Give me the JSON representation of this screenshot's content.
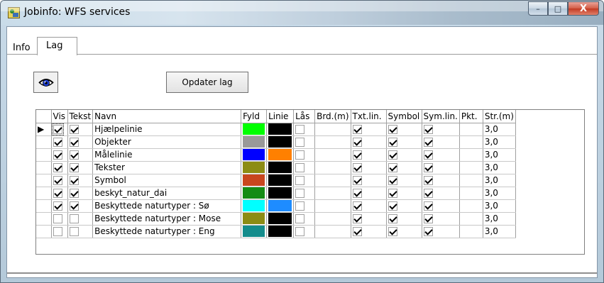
{
  "window": {
    "title": "Jobinfo: WFS services",
    "minimize_glyph": "–",
    "maximize_glyph": "□",
    "close_glyph": "X"
  },
  "tabs": [
    {
      "label": "Info",
      "active": false
    },
    {
      "label": "Lag",
      "active": true
    }
  ],
  "toolbar": {
    "eye_icon": "eye-icon",
    "update_label": "Opdater lag"
  },
  "grid": {
    "columns": [
      "Vis",
      "Tekst",
      "Navn",
      "Fyld",
      "Linie",
      "Lås",
      "Brd.(m)",
      "Txt.lin.",
      "Symbol",
      "Sym.lin.",
      "Pkt.",
      "Str.(m)"
    ],
    "row_indicator": "▶",
    "rows": [
      {
        "vis": true,
        "tekst": true,
        "navn": "Hjælpelinie",
        "fyld": "#00ff00",
        "linie": "#000000",
        "las": false,
        "brd": "",
        "txtlin": true,
        "symbol": true,
        "symlin": true,
        "pkt": "",
        "str": "3,0"
      },
      {
        "vis": true,
        "tekst": true,
        "navn": "Objekter",
        "fyld": "#999999",
        "linie": "#000000",
        "las": false,
        "brd": "",
        "txtlin": true,
        "symbol": true,
        "symlin": true,
        "pkt": "",
        "str": "3,0"
      },
      {
        "vis": true,
        "tekst": true,
        "navn": "Målelinie",
        "fyld": "#0000ff",
        "linie": "#ff8000",
        "las": false,
        "brd": "",
        "txtlin": true,
        "symbol": true,
        "symlin": true,
        "pkt": "",
        "str": "3,0"
      },
      {
        "vis": true,
        "tekst": true,
        "navn": "Tekster",
        "fyld": "#8c8c14",
        "linie": "#000000",
        "las": false,
        "brd": "",
        "txtlin": true,
        "symbol": true,
        "symlin": true,
        "pkt": "",
        "str": "3,0"
      },
      {
        "vis": true,
        "tekst": true,
        "navn": "Symbol",
        "fyld": "#c8461e",
        "linie": "#000000",
        "las": false,
        "brd": "",
        "txtlin": true,
        "symbol": true,
        "symlin": true,
        "pkt": "",
        "str": "3,0"
      },
      {
        "vis": true,
        "tekst": true,
        "navn": "beskyt_natur_dai",
        "fyld": "#148c14",
        "linie": "#000000",
        "las": false,
        "brd": "",
        "txtlin": true,
        "symbol": true,
        "symlin": true,
        "pkt": "",
        "str": "3,0"
      },
      {
        "vis": true,
        "tekst": true,
        "navn": "Beskyttede naturtyper : Sø",
        "fyld": "#00ffff",
        "linie": "#1e8cff",
        "las": false,
        "brd": "",
        "txtlin": true,
        "symbol": true,
        "symlin": true,
        "pkt": "",
        "str": "3,0"
      },
      {
        "vis": false,
        "tekst": false,
        "navn": "Beskyttede naturtyper : Mose",
        "fyld": "#8c8c14",
        "linie": "#000000",
        "las": false,
        "brd": "",
        "txtlin": true,
        "symbol": true,
        "symlin": true,
        "pkt": "",
        "str": "3,0"
      },
      {
        "vis": false,
        "tekst": false,
        "navn": "Beskyttede naturtyper : Eng",
        "fyld": "#148c8c",
        "linie": "#000000",
        "las": false,
        "brd": "",
        "txtlin": true,
        "symbol": true,
        "symlin": true,
        "pkt": "",
        "str": "3,0"
      }
    ]
  }
}
